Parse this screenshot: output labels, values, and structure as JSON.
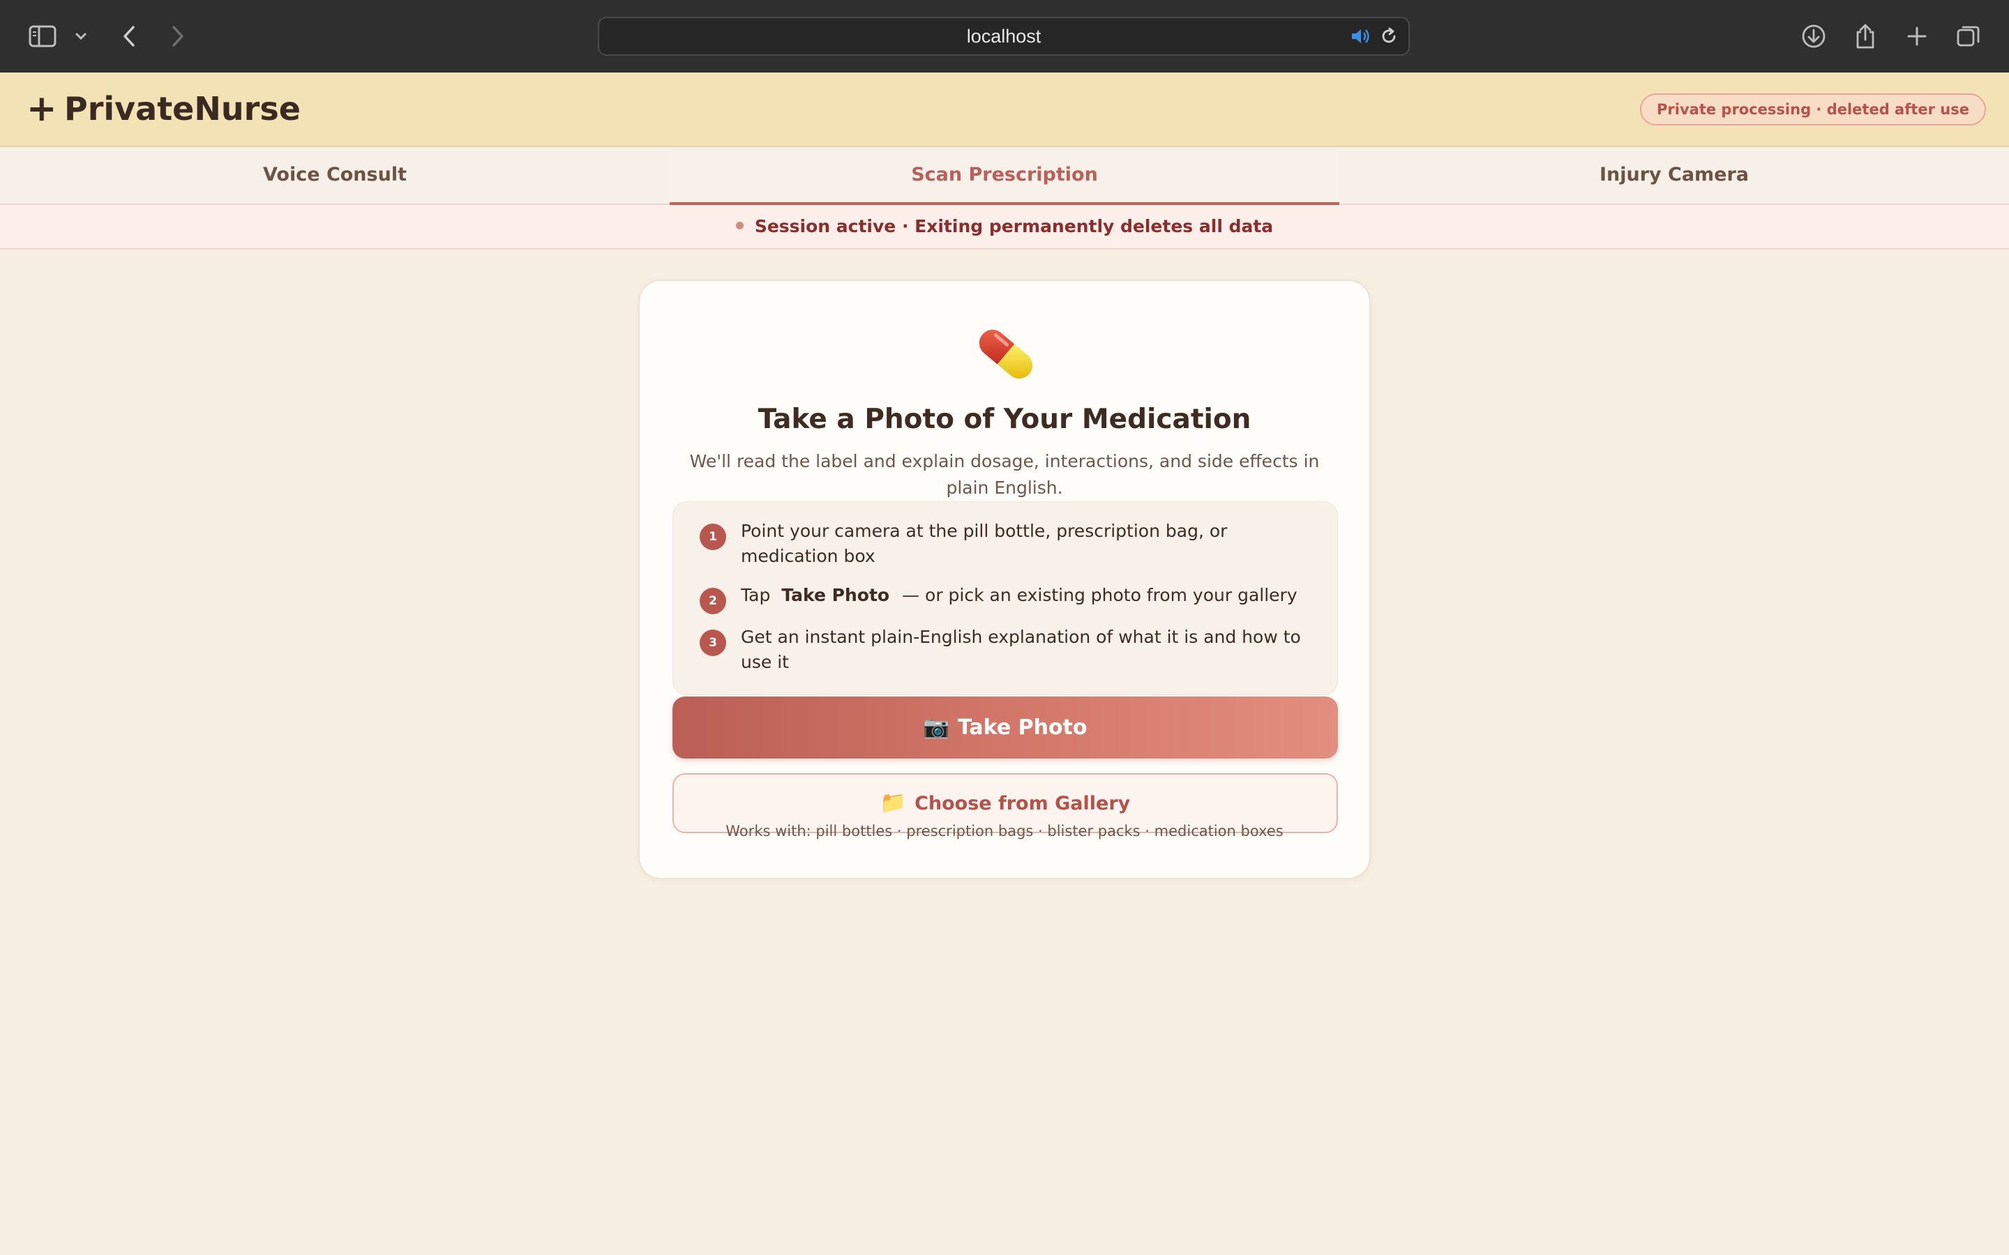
{
  "browser": {
    "url": "localhost",
    "icons": [
      "sidebar-icon",
      "chevron-down-icon",
      "back-icon",
      "forward-icon",
      "audio-icon",
      "reload-icon",
      "download-icon",
      "share-icon",
      "new-tab-icon",
      "tabs-overview-icon"
    ]
  },
  "header": {
    "brand_icon": "+",
    "brand_name": "PrivateNurse",
    "privacy_badge": "Private processing · deleted after use"
  },
  "tabs": [
    {
      "label": "Voice Consult",
      "active": false
    },
    {
      "label": "Scan Prescription",
      "active": true
    },
    {
      "label": "Injury Camera",
      "active": false
    }
  ],
  "session": {
    "text": "Session active · Exiting permanently deletes all data"
  },
  "card": {
    "icon": "pill-capsule-icon",
    "title": "Take a Photo of Your Medication",
    "subtitle": "We'll read the label and explain dosage, interactions, and side effects in plain English.",
    "steps": [
      {
        "num": "1",
        "text": "Point your camera at the pill bottle, prescription bag, or medication box"
      },
      {
        "num": "2",
        "pre": "Tap",
        "bold": "Take Photo",
        "post": "— or pick an existing photo from your gallery"
      },
      {
        "num": "3",
        "text": "Get an instant plain-English explanation of what it is and how to use it"
      }
    ],
    "take_photo_icon": "📷",
    "take_photo_label": "Take Photo",
    "gallery_icon": "📁",
    "gallery_label": "Choose from Gallery",
    "works_with": "Works with: pill bottles · prescription bags · blister packs · medication boxes"
  },
  "colors": {
    "accent": "#b9605a",
    "header_bg": "#f3e2b6",
    "page_bg": "#f7efe2",
    "button_start": "#bb5f56",
    "button_end": "#e28f80"
  }
}
